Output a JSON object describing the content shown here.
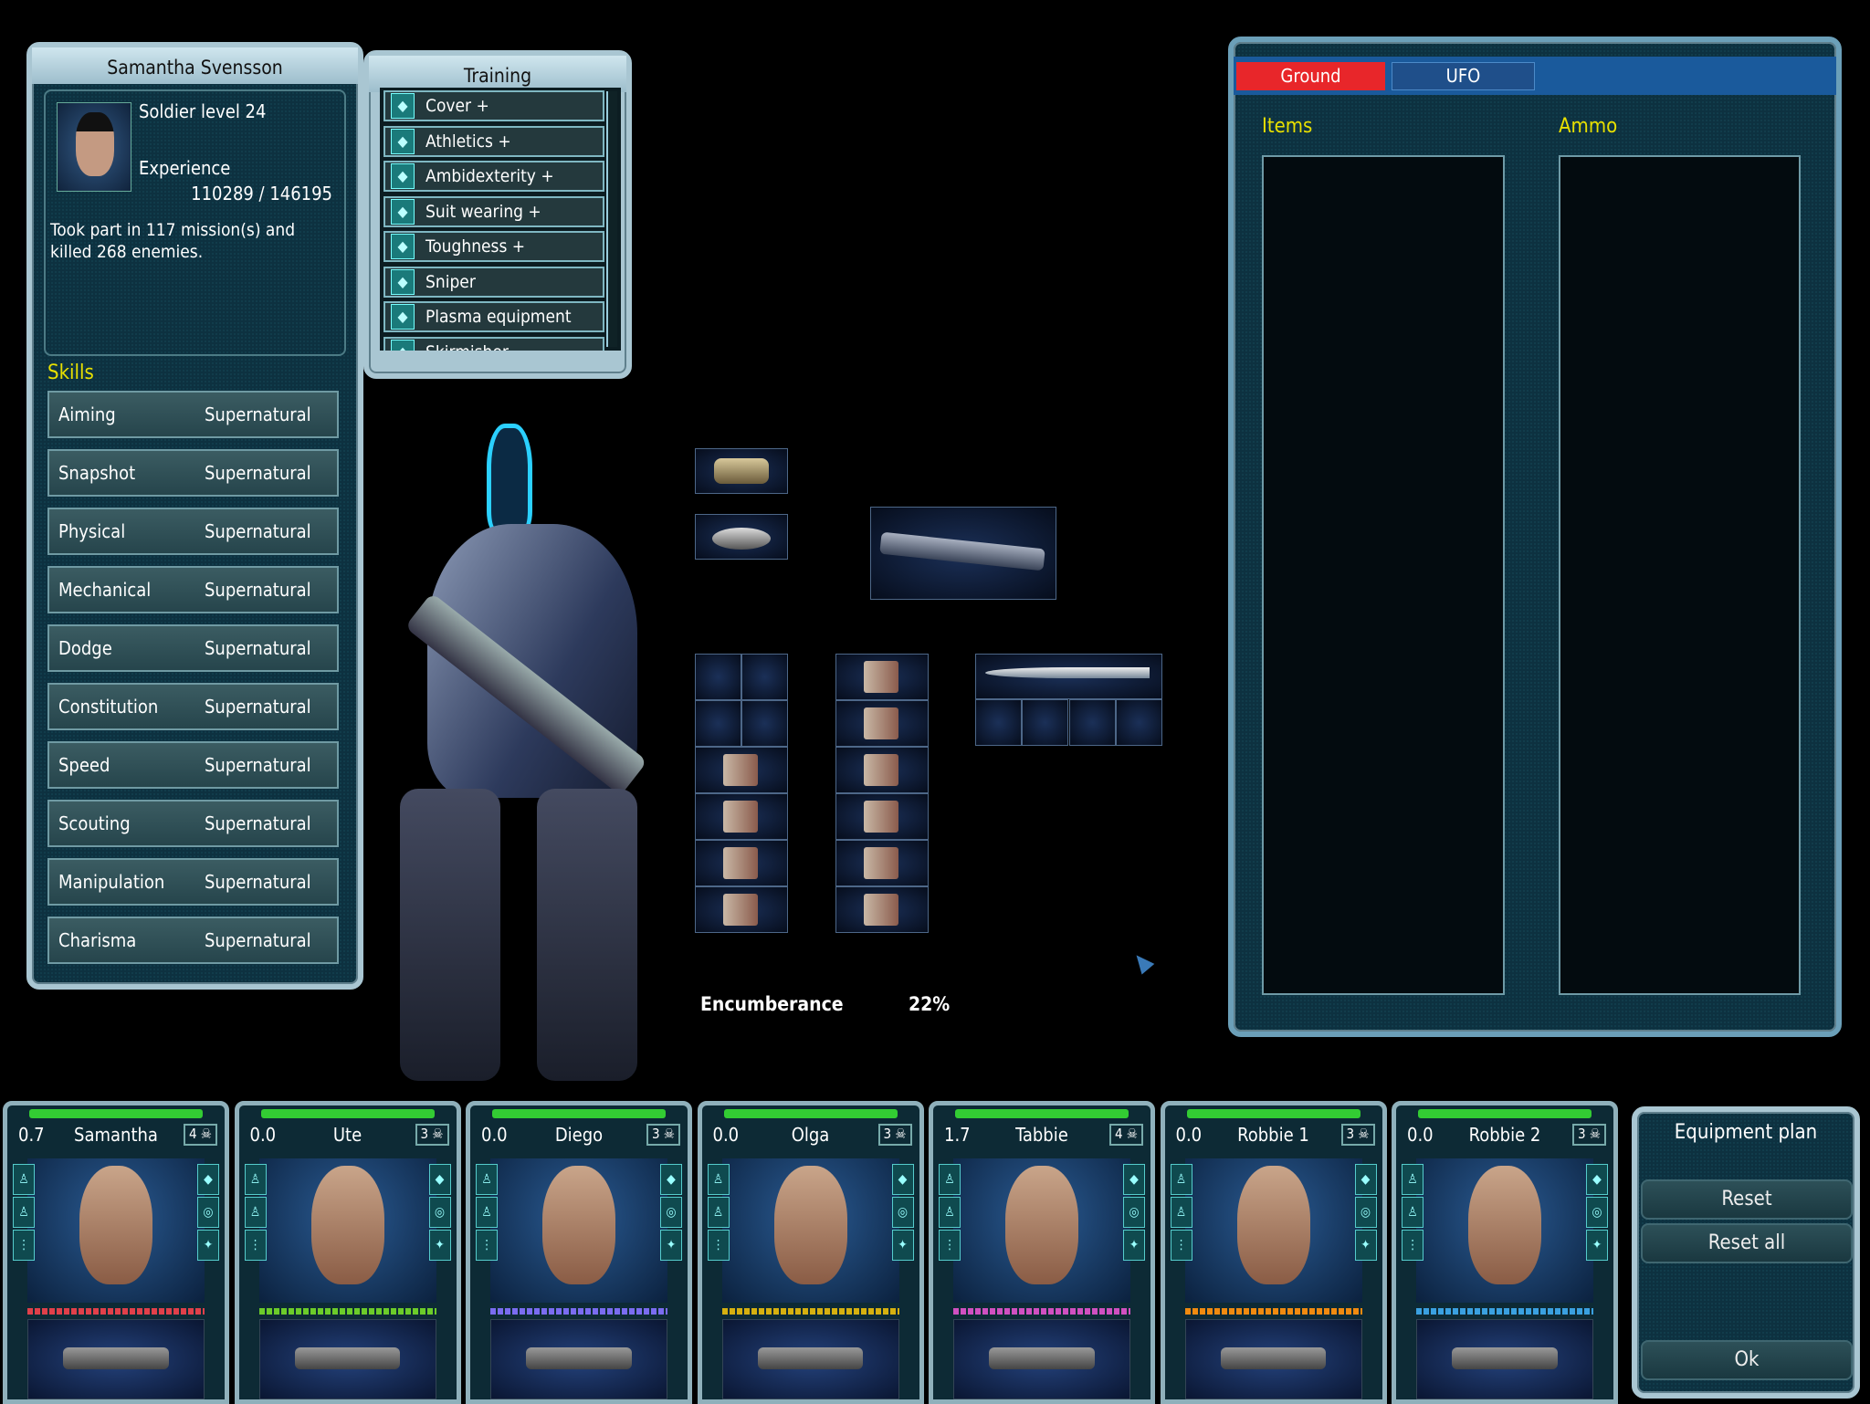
{
  "soldier": {
    "name": "Samantha Svensson",
    "level_text": "Soldier level 24",
    "experience_label": "Experience",
    "experience_value": "110289 / 146195",
    "history": "Took part in 117 mission(s) and killed 268 enemies."
  },
  "skills_title": "Skills",
  "skills": [
    {
      "name": "Aiming",
      "value": "Supernatural"
    },
    {
      "name": "Snapshot",
      "value": "Supernatural"
    },
    {
      "name": "Physical",
      "value": "Supernatural"
    },
    {
      "name": "Mechanical",
      "value": "Supernatural"
    },
    {
      "name": "Dodge",
      "value": "Supernatural"
    },
    {
      "name": "Constitution",
      "value": "Supernatural"
    },
    {
      "name": "Speed",
      "value": "Supernatural"
    },
    {
      "name": "Scouting",
      "value": "Supernatural"
    },
    {
      "name": "Manipulation",
      "value": "Supernatural"
    },
    {
      "name": "Charisma",
      "value": "Supernatural"
    }
  ],
  "training": {
    "title": "Training",
    "items": [
      {
        "label": "Cover +",
        "icon": "cover-icon"
      },
      {
        "label": "Athletics +",
        "icon": "athletics-icon"
      },
      {
        "label": "Ambidexterity +",
        "icon": "ambidexterity-icon"
      },
      {
        "label": "Suit wearing +",
        "icon": "suit-icon"
      },
      {
        "label": "Toughness +",
        "icon": "toughness-icon"
      },
      {
        "label": "Sniper",
        "icon": "crosshair-icon"
      },
      {
        "label": "Plasma equipment",
        "icon": "plasma-icon"
      },
      {
        "label": "Skirmisher",
        "icon": "skirmisher-icon"
      }
    ]
  },
  "encumbrance": {
    "label": "Encumberance",
    "value": "22%"
  },
  "storage": {
    "tabs": [
      {
        "label": "Ground",
        "active": true
      },
      {
        "label": "UFO",
        "active": false
      }
    ],
    "items_label": "Items",
    "ammo_label": "Ammo"
  },
  "squad": [
    {
      "name": "Samantha",
      "tu": "0.7",
      "rank": "4",
      "color": "#e0404a"
    },
    {
      "name": "Ute",
      "tu": "0.0",
      "rank": "3",
      "color": "#6ccc2a"
    },
    {
      "name": "Diego",
      "tu": "0.0",
      "rank": "3",
      "color": "#7a6cf0"
    },
    {
      "name": "Olga",
      "tu": "0.0",
      "rank": "3",
      "color": "#d6b010"
    },
    {
      "name": "Tabbie",
      "tu": "1.7",
      "rank": "4",
      "color": "#d050c0"
    },
    {
      "name": "Robbie 1",
      "tu": "0.0",
      "rank": "3",
      "color": "#f08a10"
    },
    {
      "name": "Robbie 2",
      "tu": "0.0",
      "rank": "3",
      "color": "#3aa0e0"
    }
  ],
  "equipment_plan": {
    "title": "Equipment plan",
    "reset": "Reset",
    "reset_all": "Reset all",
    "ok": "Ok"
  },
  "colors": {
    "active_tab": "#e8262a",
    "accent_yellow": "#e8e000",
    "panel_dark": "#0e2e3b"
  }
}
